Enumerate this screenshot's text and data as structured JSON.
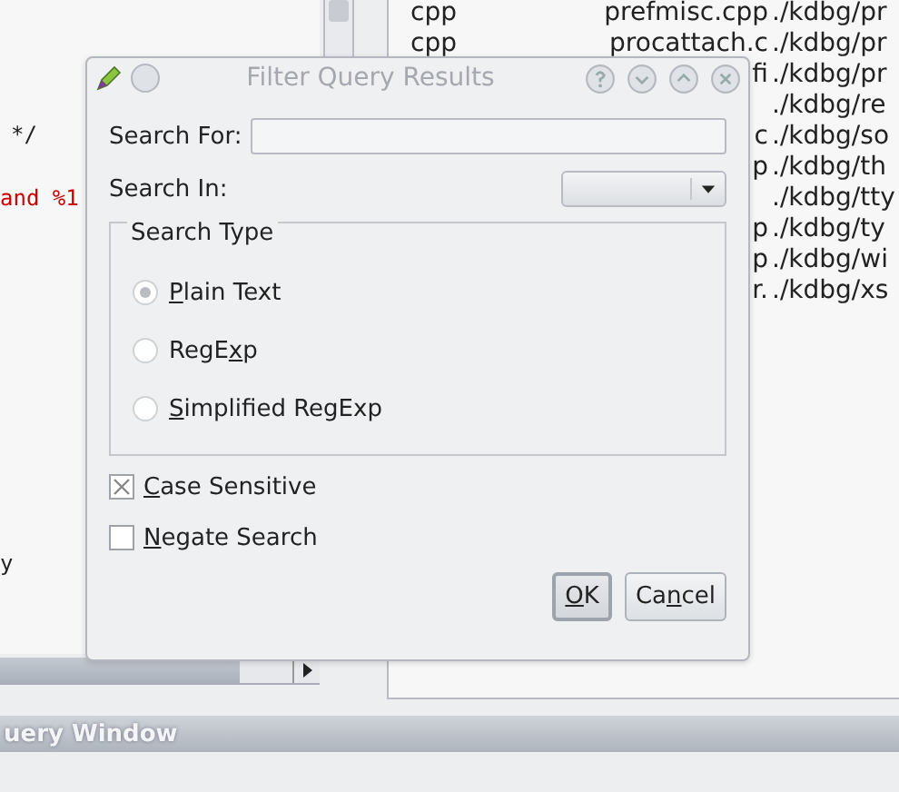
{
  "editor": {
    "lines": [
      {
        "text": "*/",
        "kind": "comment"
      },
      {
        "text": "and %1",
        "kind": "string"
      },
      {
        "text": "y",
        "kind": "plain"
      }
    ]
  },
  "file_list": {
    "rows": [
      {
        "column_1": "cpp",
        "column_2": "prefmisc.cpp",
        "column_3": "./kdbg/pr"
      },
      {
        "column_1": "cpp",
        "column_2": "procattach.c",
        "column_3": "./kdbg/pr"
      },
      {
        "column_2": "fi",
        "column_3": "./kdbg/pr"
      },
      {
        "column_3": "./kdbg/re"
      },
      {
        "column_2": "c",
        "column_3": "./kdbg/so"
      },
      {
        "column_2": "p",
        "column_3": "./kdbg/th"
      },
      {
        "column_3": "./kdbg/tty"
      },
      {
        "column_2": "p",
        "column_3": "./kdbg/ty"
      },
      {
        "column_2": "p",
        "column_3": "./kdbg/wi"
      },
      {
        "column_2": "r.",
        "column_3": "./kdbg/xs"
      }
    ]
  },
  "dialog": {
    "title": "Filter Query Results",
    "search_for": {
      "label": "Search For:"
    },
    "search_in": {
      "label": "Search In:"
    },
    "group": {
      "title": "Search Type",
      "radios": [
        {
          "label": {
            "key": "P",
            "after": "lain Text"
          },
          "selected": true
        },
        {
          "label": {
            "before": "RegE",
            "key": "x",
            "after": "p"
          },
          "selected": false
        },
        {
          "label": {
            "key": "S",
            "after": "implified RegExp"
          },
          "selected": false
        }
      ]
    },
    "checkboxes": [
      {
        "label": {
          "key": "C",
          "after": "ase Sensitive"
        },
        "checked": true
      },
      {
        "label": {
          "key": "N",
          "after": "egate Search"
        },
        "checked": false
      }
    ],
    "buttons": [
      {
        "label": {
          "key": "O",
          "after": "K"
        },
        "default": true
      },
      {
        "label": {
          "before": "Ca",
          "key": "n",
          "after": "cel"
        },
        "default": false
      }
    ]
  },
  "dock": {
    "title": "uery Window"
  }
}
